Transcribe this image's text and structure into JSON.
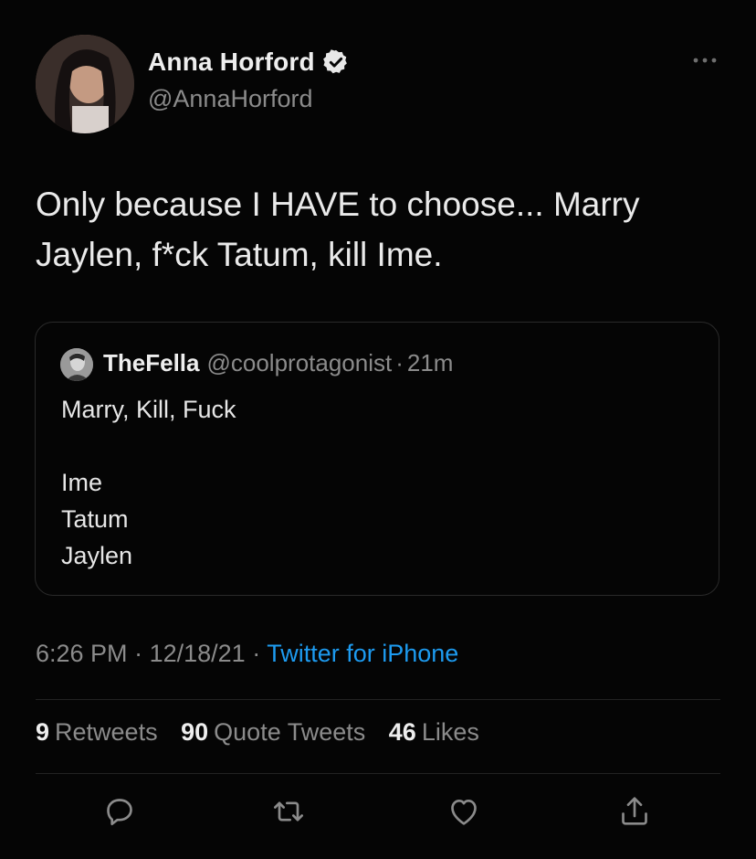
{
  "author": {
    "display_name": "Anna Horford",
    "handle": "@AnnaHorford",
    "verified": true
  },
  "tweet": {
    "text_lines": [
      "Only because I HAVE to choose... Marry",
      "Jaylen, f*ck Tatum, kill Ime."
    ]
  },
  "quote": {
    "display_name": "TheFella",
    "handle": "@coolprotagonist",
    "separator": "·",
    "time": "21m",
    "line1": "Marry, Kill, Fuck",
    "list": [
      "Ime",
      "Tatum",
      "Jaylen"
    ]
  },
  "meta": {
    "time": "6:26 PM",
    "sep1": "·",
    "date": "12/18/21",
    "sep2": "·",
    "source": "Twitter for iPhone"
  },
  "stats": {
    "retweets_count": "9",
    "retweets_label": "Retweets",
    "quotes_count": "90",
    "quotes_label": "Quote Tweets",
    "likes_count": "46",
    "likes_label": "Likes"
  },
  "colors": {
    "background": "#050505",
    "accent": "#1d9bf0",
    "secondary_text": "#8b8b8b"
  },
  "icons": [
    "verified-badge-icon",
    "more-options-icon",
    "reply-icon",
    "retweet-icon",
    "like-icon",
    "share-icon"
  ]
}
